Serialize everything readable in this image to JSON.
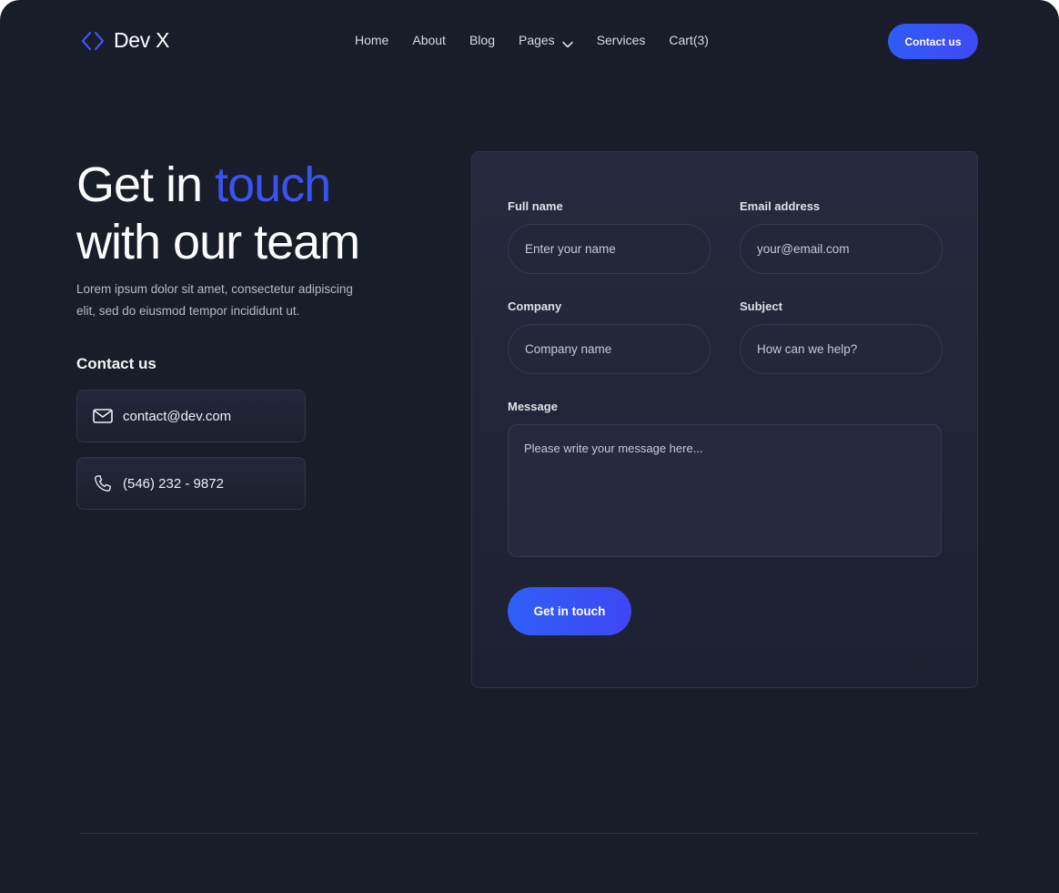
{
  "brand": {
    "name": "Dev X",
    "icon": "code-brackets-icon",
    "accent": "#3b52f0"
  },
  "nav": {
    "items": [
      {
        "label": "Home"
      },
      {
        "label": "About"
      },
      {
        "label": "Blog"
      },
      {
        "label": "Pages",
        "icon": "chevron-down-icon"
      },
      {
        "label": "Services"
      },
      {
        "label": "Cart(3)"
      }
    ],
    "cta_label": "Contact us"
  },
  "hero": {
    "title_line1_prefix": "Get in ",
    "title_line1_accent": "touch",
    "title_line2": "with our team",
    "subtitle": "Lorem ipsum dolor sit amet, consectetur adipiscing elit, sed do eiusmod tempor incididunt ut."
  },
  "contact": {
    "heading": "Contact us",
    "email": {
      "value": "contact@dev.com",
      "icon": "mail-icon"
    },
    "phone": {
      "value": "(546) 232 - 9872",
      "icon": "phone-icon"
    }
  },
  "form": {
    "full_name": {
      "label": "Full name",
      "placeholder": "Enter your name"
    },
    "email": {
      "label": "Email address",
      "placeholder": "your@email.com"
    },
    "company": {
      "label": "Company",
      "placeholder": "Company name"
    },
    "subject": {
      "label": "Subject",
      "placeholder": "How can we help?"
    },
    "message": {
      "label": "Message",
      "placeholder": "Please write your message here..."
    },
    "submit_label": "Get in touch"
  },
  "colors": {
    "background": "#191c29",
    "primary_button": "#2f5cf7",
    "accent_text": "#3b52f0"
  }
}
